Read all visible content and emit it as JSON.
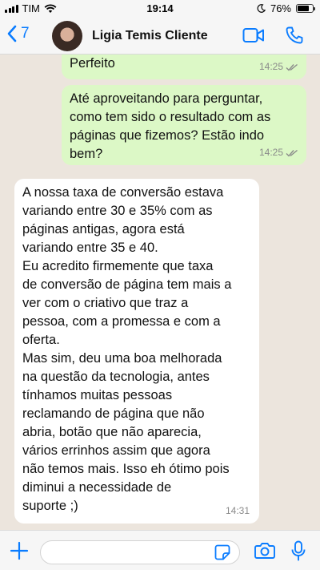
{
  "status_bar": {
    "carrier": "TIM",
    "time": "19:14",
    "battery": "76%",
    "battery_level": 0.76
  },
  "header": {
    "back_count": "7",
    "contact_name": "Ligia Temis Cliente"
  },
  "messages": [
    {
      "direction": "outgoing",
      "text": "Perfeito",
      "time": "14:25",
      "status": "read"
    },
    {
      "direction": "outgoing",
      "text": "Até aproveitando para perguntar,\ncomo tem sido o resultado com as\npáginas que fizemos? Estão indo\nbem?",
      "time": "14:25",
      "status": "read"
    },
    {
      "direction": "incoming",
      "text": "A nossa taxa de conversão estava\nvariando entre 30 e 35% com as\npáginas antigas, agora está\nvariando entre 35 e 40.\nEu acredito firmemente que taxa\nde conversão de página tem mais a\nver com o criativo que traz a\npessoa, com a promessa e com a\noferta.\nMas sim, deu uma boa melhorada\nna questão da tecnologia, antes\ntínhamos muitas pessoas\nreclamando de página que não\nabria, botão que não aparecia,\nvários errinhos assim que agora\nnão temos mais. Isso eh ótimo pois\ndiminui a necessidade de\nsuporte ;)",
      "time": "14:31"
    }
  ],
  "input": {
    "value": "",
    "placeholder": ""
  },
  "colors": {
    "accent": "#0a7cff",
    "outgoing_bubble": "#dcf8c6",
    "incoming_bubble": "#ffffff",
    "chat_background": "#ece5dd"
  },
  "icons": {
    "back": "chevron-left-icon",
    "video": "video-camera-icon",
    "call": "phone-icon",
    "add": "plus-icon",
    "sticker": "sticker-icon",
    "camera": "camera-icon",
    "mic": "microphone-icon",
    "read": "double-check-icon"
  }
}
